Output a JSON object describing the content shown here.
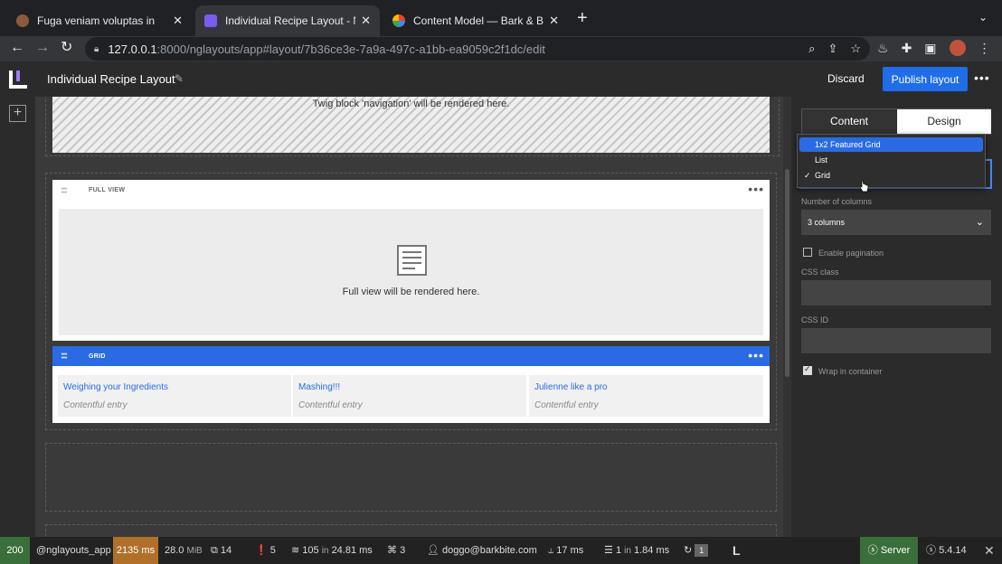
{
  "browser": {
    "tabs": [
      {
        "title": "Fuga veniam voluptas in",
        "favicon_color": "#8b5a3c"
      },
      {
        "title": "Individual Recipe Layout - Netgen",
        "favicon_color": "#7b5cf0"
      },
      {
        "title": "Content Model — Bark & Bake",
        "favicon_color": "#f4b400"
      }
    ],
    "url_host": "127.0.0.1",
    "url_path": ":8000/nglayouts/app#layout/7b36ce3e-7a9a-497c-a1bb-ea9059c2f1dc/edit"
  },
  "app": {
    "layout_title": "Individual Recipe Layout",
    "discard_label": "Discard",
    "publish_label": "Publish layout",
    "accent": "#1f6de8"
  },
  "canvas": {
    "nav_block_text": "Twig block 'navigation' will be rendered here.",
    "full_view_label": "FULL VIEW",
    "full_view_text": "Full view will be rendered here.",
    "grid_label": "GRID",
    "grid_items": [
      {
        "title": "Weighing your Ingredients",
        "subtitle": "Contentful entry"
      },
      {
        "title": "Mashing!!!",
        "subtitle": "Contentful entry"
      },
      {
        "title": "Julienne like a pro",
        "subtitle": "Contentful entry"
      }
    ]
  },
  "panel": {
    "tab_content": "Content",
    "tab_design": "Design",
    "view_options": [
      {
        "label": "1x2 Featured Grid",
        "highlighted": true,
        "checked": false
      },
      {
        "label": "List",
        "highlighted": false,
        "checked": false
      },
      {
        "label": "Grid",
        "highlighted": false,
        "checked": true
      }
    ],
    "columns_label": "Number of columns",
    "columns_value": "3 columns",
    "pagination_label": "Enable pagination",
    "pagination_checked": false,
    "css_class_label": "CSS class",
    "css_id_label": "CSS ID",
    "wrap_label": "Wrap in container",
    "wrap_checked": true
  },
  "debug": {
    "status": "200",
    "route": "@nglayouts_app",
    "time": "2135 ms",
    "memory_value": "28.0",
    "memory_unit": "MiB",
    "forms": "14",
    "exceptions": "5",
    "cache_count": "105",
    "cache_in": "in",
    "cache_time": "24.81 ms",
    "translations": "3",
    "user": "doggo@barkbite.com",
    "twig_time": "17 ms",
    "db_count": "1",
    "db_in": "in",
    "db_time": "1.84 ms",
    "ajax": "1",
    "server": "Server",
    "symfony_version": "5.4.14"
  }
}
